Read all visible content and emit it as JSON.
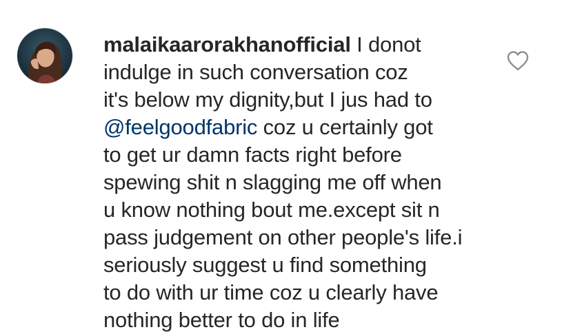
{
  "comment": {
    "username": "malaikaarorakhanofficial",
    "text_line_1": " I donot",
    "lines": [
      "indulge in such conversation coz",
      "it's below my dignity,but I jus had to"
    ],
    "mention": "@feelgoodfabric",
    "mention_after": " coz u certainly got",
    "lines_after": [
      "to get ur damn facts right before",
      "spewing shit n slagging me off when",
      "u know nothing bout me.except sit n",
      "pass judgement on other people's life.i",
      "seriously suggest u find something",
      "to do with ur time coz u clearly have",
      "nothing better to do in life"
    ]
  },
  "icons": {
    "avatar": "profile-avatar",
    "like": "heart-outline-icon"
  },
  "colors": {
    "text": "#262626",
    "mention": "#003569",
    "background": "#ffffff"
  }
}
